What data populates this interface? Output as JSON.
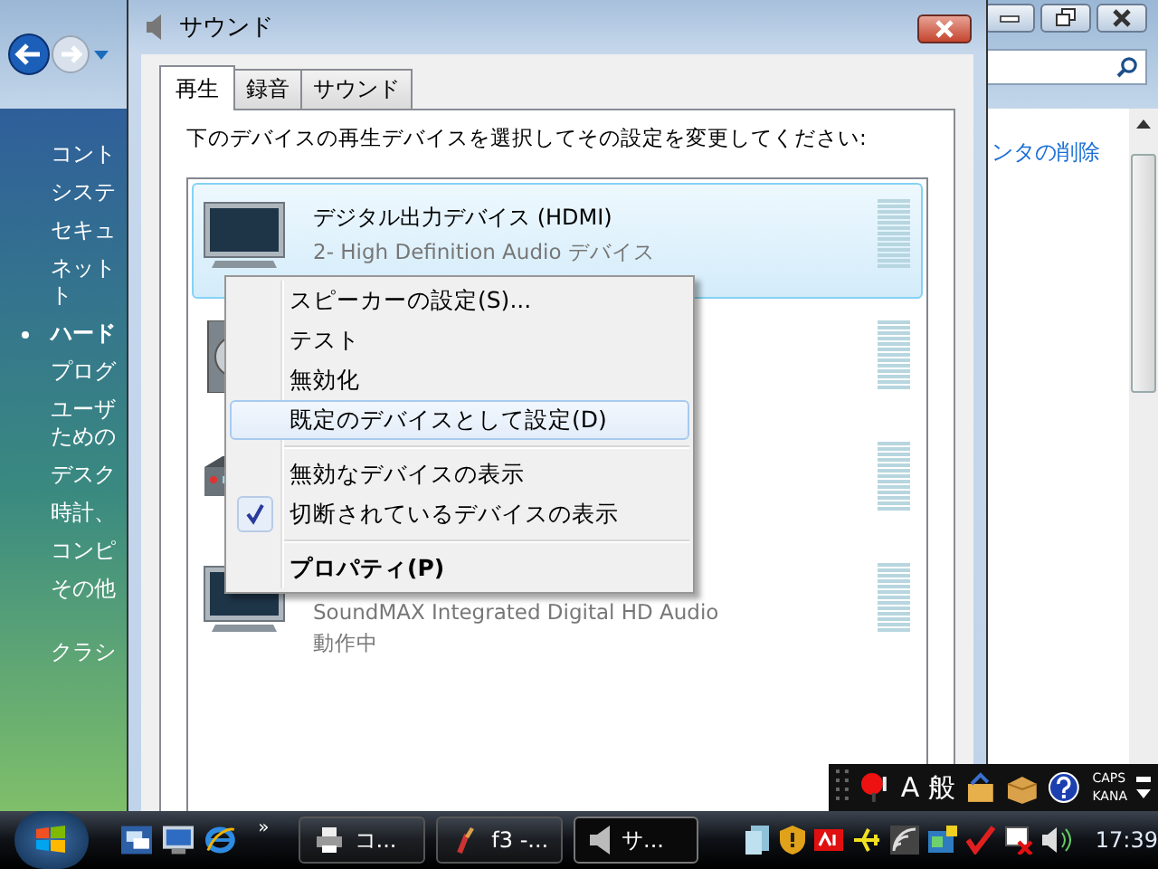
{
  "background_window": {
    "sidebar": [
      {
        "kind": "item",
        "label": "コント",
        "active": false
      },
      {
        "kind": "item",
        "label": "システ",
        "active": false
      },
      {
        "kind": "item",
        "label": "セキュ",
        "active": false
      },
      {
        "kind": "item",
        "label": "ネット",
        "active": false
      },
      {
        "kind": "wrap",
        "label": "ト",
        "active": false
      },
      {
        "kind": "item",
        "label": "ハード",
        "active": true
      },
      {
        "kind": "item",
        "label": "プログ",
        "active": false
      },
      {
        "kind": "item",
        "label": "ユーザ",
        "active": false
      },
      {
        "kind": "wrap",
        "label": "ための",
        "active": false
      },
      {
        "kind": "item",
        "label": "デスク",
        "active": false
      },
      {
        "kind": "item",
        "label": "時計、",
        "active": false
      },
      {
        "kind": "item",
        "label": "コンピ",
        "active": false
      },
      {
        "kind": "item",
        "label": "その他",
        "active": false
      },
      {
        "kind": "gap",
        "label": "クラシ",
        "active": false
      }
    ],
    "link": "ンタの削除"
  },
  "dialog": {
    "title": "サウンド",
    "tabs": [
      {
        "label": "再生",
        "selected": true
      },
      {
        "label": "録音",
        "selected": false
      },
      {
        "label": "サウンド",
        "selected": false
      }
    ],
    "instruction": "下のデバイスの再生デバイスを選択してその設定を変更してください:",
    "devices": [
      {
        "kind": "tv",
        "name": "デジタル出力デバイス (HDMI)",
        "driver": "2- High Definition Audio デバイス",
        "selected": true
      },
      {
        "kind": "speaker",
        "selected": false
      },
      {
        "kind": "receiver",
        "selected": false
      },
      {
        "kind": "tv",
        "driver": "SoundMAX Integrated Digital HD Audio",
        "status": "動作中",
        "selected": false
      }
    ]
  },
  "context_menu": [
    {
      "kind": "item",
      "label": "スピーカーの設定(S)...",
      "selected": false,
      "checked": false,
      "default": false
    },
    {
      "kind": "item",
      "label": "テスト",
      "selected": false,
      "checked": false,
      "default": false
    },
    {
      "kind": "item",
      "label": "無効化",
      "selected": false,
      "checked": false,
      "default": false
    },
    {
      "kind": "item",
      "label": "既定のデバイスとして設定(D)",
      "selected": true,
      "checked": false,
      "default": false
    },
    {
      "kind": "separator"
    },
    {
      "kind": "item",
      "label": "無効なデバイスの表示",
      "selected": false,
      "checked": false,
      "default": false
    },
    {
      "kind": "item",
      "label": "切断されているデバイスの表示",
      "selected": false,
      "checked": true,
      "default": false
    },
    {
      "kind": "separator"
    },
    {
      "kind": "item",
      "label": "プロパティ(P)",
      "selected": false,
      "checked": false,
      "default": true
    }
  ],
  "language_bar": {
    "input_mode": "A",
    "conversion": "般",
    "caps": "CAPS",
    "kana": "KANA"
  },
  "taskbar": {
    "more": "»",
    "tasks": [
      {
        "kind": "printer",
        "label": "コ...",
        "selected": false
      },
      {
        "kind": "brush",
        "label": "f3 -...",
        "selected": false
      },
      {
        "kind": "speaker",
        "label": "サ...",
        "selected": true
      }
    ],
    "clock": "17:39"
  }
}
